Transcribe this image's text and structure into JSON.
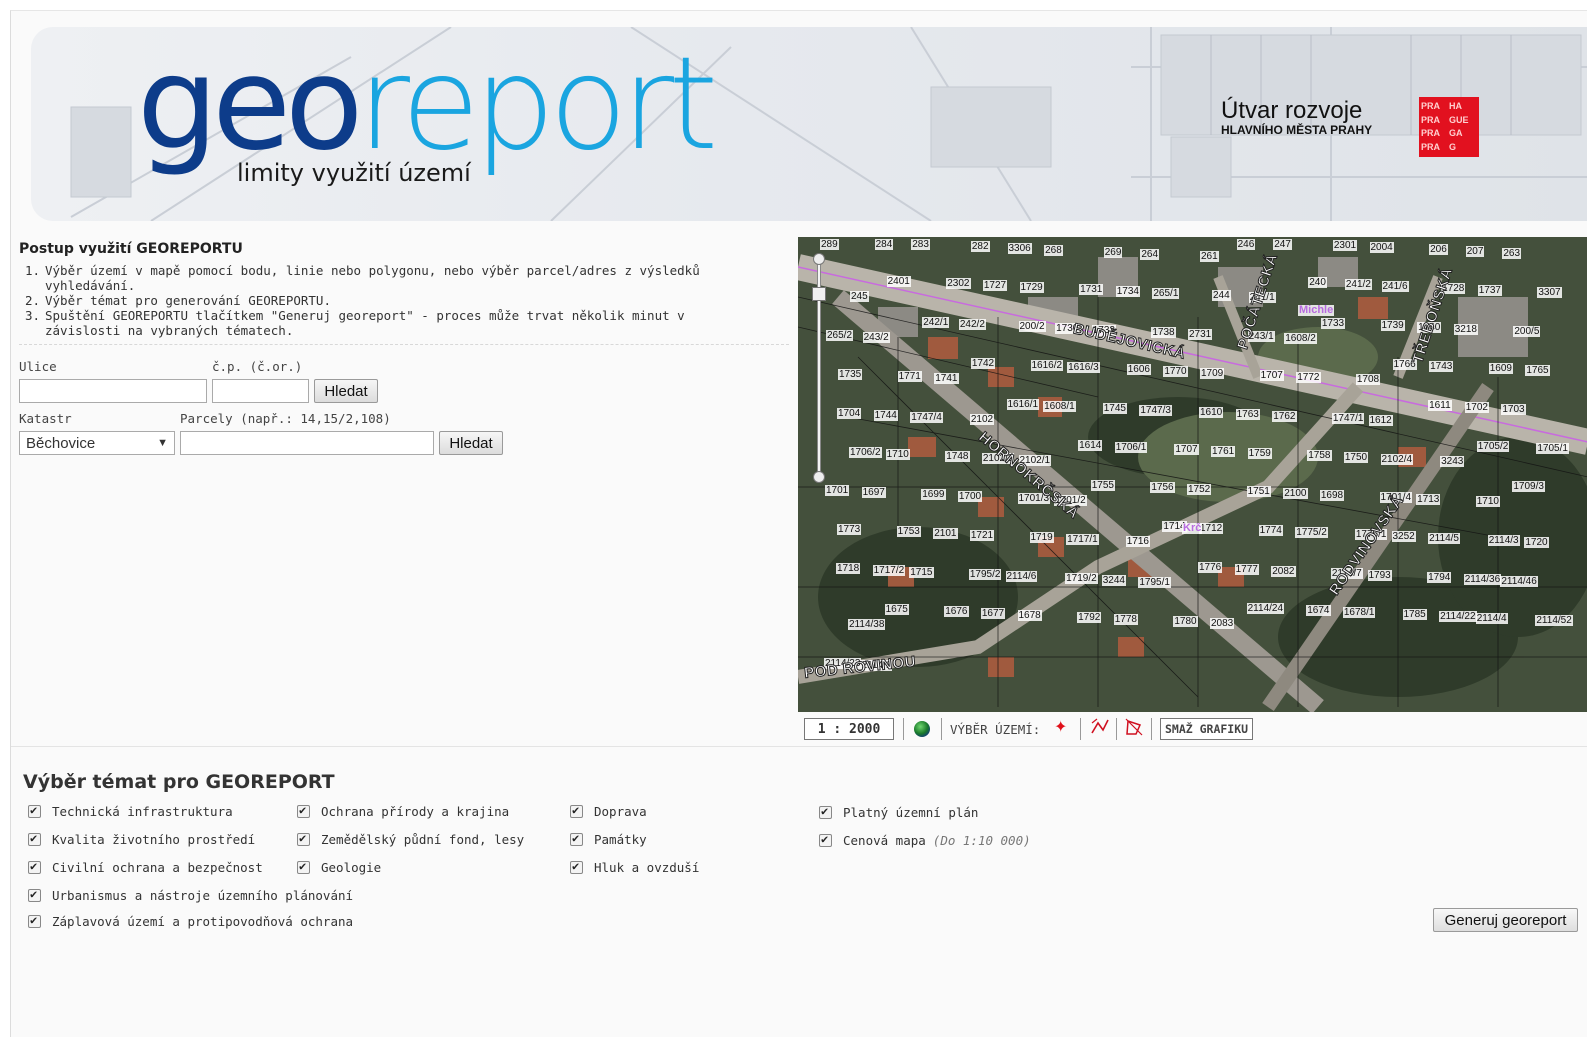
{
  "header": {
    "logo_geo": "geo",
    "logo_report": "report",
    "subtitle": "limity využití území",
    "org_line1": "Útvar rozvoje",
    "org_line2": "HLAVNÍHO MĚSTA PRAHY",
    "praha_logo_cells": [
      "PRA",
      "HA",
      "PRA",
      "GUE",
      "PRA",
      "GA",
      "PRA",
      "G"
    ]
  },
  "procedure": {
    "title": "Postup využití GEOREPORTU",
    "steps": [
      {
        "num": "1.",
        "text": "Výběr území v mapě pomocí bodu, linie nebo polygonu, nebo výběr parcel/adres z výsledků vyhledávání."
      },
      {
        "num": "2.",
        "text": "Výběr témat pro generování GEOREPORTU."
      },
      {
        "num": "3.",
        "text": "Spuštění GEOREPORTU tlačítkem \"Generuj georeport\" - proces může trvat několik minut v závislosti na vybraných tématech."
      }
    ]
  },
  "address_search": {
    "street_label": "Ulice",
    "number_label": "č.p. (č.or.)",
    "street_value": "",
    "number_value": "",
    "button": "Hledat"
  },
  "parcel_search": {
    "cadastre_label": "Katastr",
    "parcels_label": "Parcely (např.: 14,15/2,108)",
    "cadastre_selected": "Běchovice",
    "parcels_value": "",
    "button": "Hledat"
  },
  "map": {
    "streets": [
      "BUDĚJOVICKÁ",
      "POČÁTECKÁ",
      "TŘEBOŇSKÁ",
      "HORNOKRČSKÁ",
      "RODVINOVSKÁ",
      "POD ROVINOU"
    ],
    "place_labels": [
      "Michle",
      "Krč"
    ],
    "parcel_numbers": [
      "289",
      "284",
      "283",
      "282",
      "3306",
      "268",
      "269",
      "264",
      "261",
      "246",
      "247",
      "2301",
      "2004",
      "206",
      "207",
      "263",
      "245",
      "2401",
      "2302",
      "1727",
      "1729",
      "1731",
      "1734",
      "265/1",
      "244",
      "241/1",
      "240",
      "241/2",
      "241/6",
      "1728",
      "1737",
      "3307",
      "265/2",
      "243/2",
      "242/1",
      "242/2",
      "200/2",
      "1730",
      "1732",
      "1738",
      "2731",
      "243/1",
      "1608/2",
      "1733",
      "1739",
      "1740",
      "3218",
      "200/5",
      "1735",
      "1771",
      "1741",
      "1742",
      "1616/2",
      "1616/3",
      "1606",
      "1770",
      "1709",
      "1707",
      "1772",
      "1708",
      "1766",
      "1743",
      "1609",
      "1765",
      "1704",
      "1744",
      "1747/4",
      "2102",
      "1616/1",
      "1608/1",
      "1745",
      "1747/3",
      "1610",
      "1763",
      "1762",
      "1747/1",
      "1612",
      "1611",
      "1702",
      "1703",
      "1706/2",
      "1710",
      "1748",
      "2102/3",
      "2102/1",
      "1614",
      "1706/1",
      "1707",
      "1761",
      "1759",
      "1758",
      "1750",
      "2102/4",
      "3243",
      "1705/2",
      "1705/1",
      "1701",
      "1697",
      "1699",
      "1700",
      "1701/3",
      "1701/2",
      "1755",
      "1756",
      "1752",
      "1751",
      "2100",
      "1698",
      "1701/4",
      "1713",
      "1710",
      "1709/3",
      "1773",
      "1753",
      "2101",
      "1721",
      "1719",
      "1717/1",
      "1716",
      "1714",
      "1712",
      "1774",
      "1775/2",
      "1775/1",
      "3252",
      "2114/5",
      "2114/3",
      "1720",
      "1718",
      "1717/2",
      "1715",
      "1795/2",
      "2114/6",
      "1719/2",
      "3244",
      "1795/1",
      "1776",
      "1777",
      "2082",
      "2114/7",
      "1793",
      "1794",
      "2114/36",
      "2114/46",
      "2114/38",
      "1675",
      "1676",
      "1677",
      "1678",
      "1792",
      "1778",
      "1780",
      "2083",
      "2114/24",
      "1674",
      "1678/1",
      "1785",
      "2114/22",
      "2114/4",
      "2114/52",
      "2114/23",
      "2114/1"
    ]
  },
  "map_toolbar": {
    "scale": "1 : 2000",
    "selection_label": "VÝBĚR ÚZEMÍ:",
    "clear_button": "SMAŽ GRAFIKU",
    "icons": [
      "globe-icon",
      "point-select-icon",
      "line-select-icon",
      "polygon-select-icon"
    ]
  },
  "topics": {
    "title": "Výběr témat pro GEOREPORT",
    "items": [
      {
        "label": "Technická infrastruktura",
        "checked": true
      },
      {
        "label": "Ochrana přírody a krajina",
        "checked": true
      },
      {
        "label": "Doprava",
        "checked": true
      },
      {
        "label": "Platný územní plán",
        "checked": true
      },
      {
        "label": "Kvalita životního prostředí",
        "checked": true
      },
      {
        "label": "Zemědělský půdní fond, lesy",
        "checked": true
      },
      {
        "label": "Památky",
        "checked": true
      },
      {
        "label": "Cenová mapa",
        "note": "(Do 1:10 000)",
        "checked": true
      },
      {
        "label": "Civilní ochrana a bezpečnost",
        "checked": true
      },
      {
        "label": "Geologie",
        "checked": true
      },
      {
        "label": "Hluk a ovzduší",
        "checked": true
      },
      {
        "label": "Urbanismus a nástroje územního plánování",
        "checked": true
      },
      {
        "label": "Záplavová území a protipovodňová ochrana",
        "checked": true
      }
    ],
    "generate_button": "Generuj georeport"
  }
}
